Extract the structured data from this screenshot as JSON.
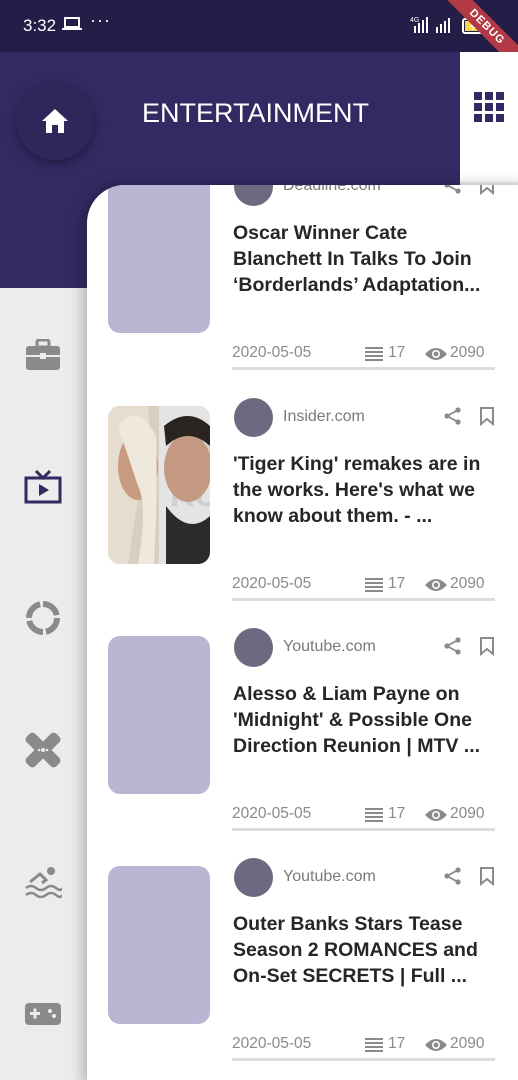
{
  "status_bar": {
    "time": "3:32",
    "dots": "···",
    "network": "4G",
    "debug_label": "DEBUG"
  },
  "header": {
    "title": "ENTERTAINMENT"
  },
  "sidebar": {
    "items": [
      {
        "icon": "briefcase-icon"
      },
      {
        "icon": "tv-icon",
        "active": true
      },
      {
        "icon": "circle-progress-icon"
      },
      {
        "icon": "bandage-icon"
      },
      {
        "icon": "swimming-icon"
      },
      {
        "icon": "gamepad-icon"
      }
    ]
  },
  "articles": [
    {
      "source": "Deadline.com",
      "title": "Oscar Winner Cate Blanchett In Talks To Join ‘Borderlands’ Adaptation...",
      "date": "2020-05-05",
      "count": "17",
      "views": "2090",
      "has_image": false
    },
    {
      "source": "Insider.com",
      "title": "'Tiger King' remakes are in the works. Here's what we know about them. - ...",
      "date": "2020-05-05",
      "count": "17",
      "views": "2090",
      "has_image": true
    },
    {
      "source": "Youtube.com",
      "title": "Alesso & Liam Payne on 'Midnight' & Possible One Direction Reunion | MTV ...",
      "date": "2020-05-05",
      "count": "17",
      "views": "2090",
      "has_image": false
    },
    {
      "source": "Youtube.com",
      "title": "Outer Banks Stars Tease Season 2 ROMANCES and On-Set SECRETS | Full ...",
      "date": "2020-05-05",
      "count": "17",
      "views": "2090",
      "has_image": false
    }
  ],
  "colors": {
    "header_bg": "#322a62",
    "status_bg": "#231d47",
    "accent": "#322a62",
    "placeholder": "#b9b5d3"
  }
}
